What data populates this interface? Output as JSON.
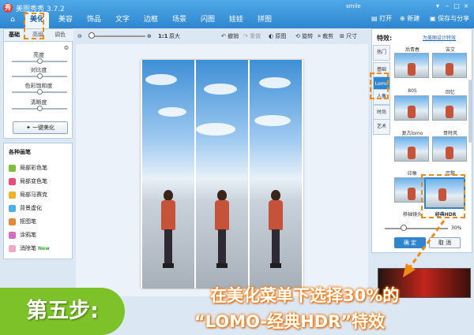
{
  "app": {
    "title": "美图秀秀 3.7.2",
    "user": "smile"
  },
  "window_controls": [
    "▾",
    "–",
    "□",
    "×"
  ],
  "tabs": [
    "美化",
    "美容",
    "饰品",
    "文字",
    "边框",
    "场景",
    "闪图",
    "娃娃",
    "拼图"
  ],
  "top_actions": {
    "open": "打开",
    "new": "新建",
    "save": "保存与分享"
  },
  "left_panel": {
    "subtabs": [
      "基础",
      "高级",
      "调色"
    ],
    "sliders": [
      {
        "label": "亮度",
        "value": 0.5
      },
      {
        "label": "对比度",
        "value": 0.5
      },
      {
        "label": "色彩饱和度",
        "value": 0.5
      },
      {
        "label": "清晰度",
        "value": 0.5
      }
    ],
    "one_click": "一键美化"
  },
  "brushes": {
    "title": "各种画笔",
    "items": [
      "局部彩色笔",
      "局部变色笔",
      "局部马赛克",
      "背景虚化",
      "抠图笔",
      "涂鸦笔",
      "消除笔"
    ],
    "new_badge": "New"
  },
  "toolbar": {
    "zoom_ratio": "1:1",
    "original_size": "原大",
    "undo": "撤销",
    "redo": "重做",
    "original": "原图",
    "rotate": "旋转",
    "crop": "裁剪",
    "size": "尺寸"
  },
  "effects": {
    "title": "特效:",
    "design_link": "为美图设计特效",
    "vtabs": [
      "热门",
      "基础",
      "Lomo",
      "人像",
      "时尚",
      "艺术"
    ],
    "active_vtab": "Lomo",
    "thumbnails": [
      {
        "label": "后青春"
      },
      {
        "label": "苦艾"
      },
      {
        "label": "80S"
      },
      {
        "label": "回忆"
      },
      {
        "label": "复古lomo"
      },
      {
        "label": "哥特风"
      },
      {
        "label": "印象"
      },
      {
        "label": "巴黎"
      },
      {
        "label": "移轴镜头"
      },
      {
        "label": "经典HDR"
      }
    ],
    "selected": "经典HDR",
    "opacity": "30%",
    "opacity_value": 0.3,
    "ok": "确 定",
    "cancel": "取 消"
  },
  "annotation": {
    "step": "第五步:",
    "caption_line1": "在美化菜单下选择30%的",
    "caption_line2": "“LOMO-经典HDR”特效"
  },
  "colors": {
    "accent": "#2f86cf",
    "annotation": "#f08a12",
    "badge": "#7ec229"
  }
}
